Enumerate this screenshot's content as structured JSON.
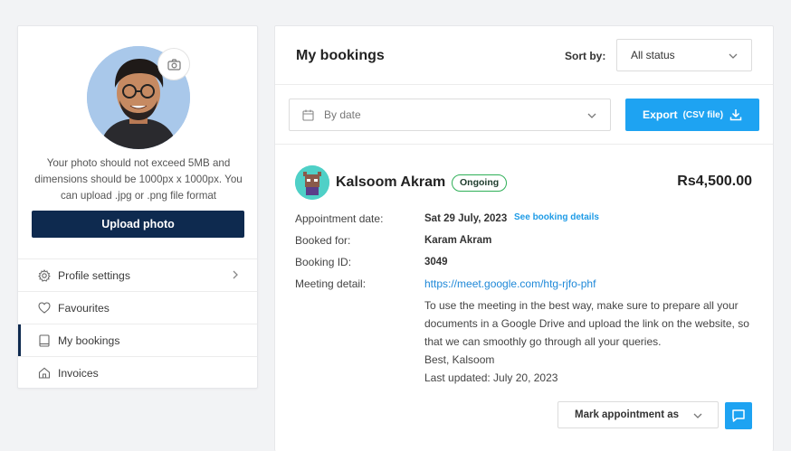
{
  "profile": {
    "photo_note": "Your photo should not exceed 5MB and dimensions should be 1000px x 1000px. You can upload .jpg or .png file format",
    "upload_label": "Upload photo"
  },
  "menu": {
    "items": [
      {
        "label": "Profile settings",
        "icon": "gear-icon"
      },
      {
        "label": "Favourites",
        "icon": "heart-icon"
      },
      {
        "label": "My bookings",
        "icon": "book-icon"
      },
      {
        "label": "Invoices",
        "icon": "home-icon"
      }
    ]
  },
  "bookings": {
    "title": "My bookings",
    "sort_label": "Sort by:",
    "status_value": "All status",
    "date_placeholder": "By date",
    "export_label": "Export",
    "export_sub": "(CSV file)"
  },
  "booking": {
    "name": "Kalsoom Akram",
    "status": "Ongoing",
    "price": "Rs4,500.00",
    "appointment_label": "Appointment date:",
    "appointment_value": "Sat 29 July, 2023",
    "see_details": "See booking details",
    "booked_for_label": "Booked for:",
    "booked_for_value": "Karam Akram",
    "booking_id_label": "Booking ID:",
    "booking_id_value": "3049",
    "meeting_label": "Meeting detail:",
    "meeting_link": "https://meet.google.com/htg-rjfo-phf",
    "meeting_desc": "To use the meeting in the best way, make sure to prepare all your documents in a Google Drive and upload the link on the website, so that we can smoothly go through all your queries.",
    "sign_off": "Best, Kalsoom",
    "last_updated": "Last updated: July 20, 2023",
    "mark_label": "Mark appointment as"
  },
  "colors": {
    "primary_dark": "#0e2a4f",
    "accent_blue": "#1ea3f2",
    "ongoing_green": "#2eaf57"
  }
}
